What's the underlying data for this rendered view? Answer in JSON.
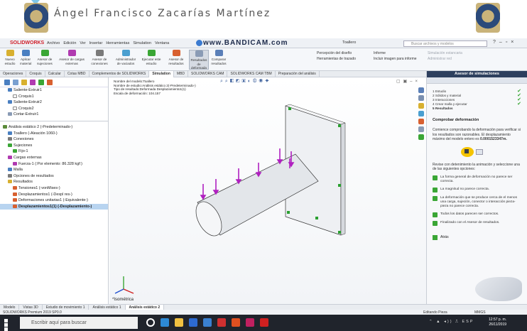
{
  "banner": {
    "author": "Ángel Francisco Zacarías Martínez"
  },
  "menubar": {
    "logo": "SOLIDWORKS",
    "items": [
      "Archivo",
      "Edición",
      "Ver",
      "Insertar",
      "Herramientas",
      "Simulation",
      "Ventana"
    ],
    "watermark": "www.BANDICAM.com",
    "document_title": "Toallero",
    "search_placeholder": "Buscar archivos y modelos"
  },
  "ribbon": {
    "buttons": [
      "Nuevo estudio",
      "Aplicar material",
      "Asesor de sujeciones",
      "Asesor de cargas externas",
      "Asesor de conexiones",
      "Administrador de vaciados",
      "Ejecutar este estudio",
      "Asesor de resultados",
      "Resultados de deformada",
      "Comparar resultados"
    ],
    "list_items": [
      "Percepción del diseño",
      "Herramientas de trazado",
      "Informe",
      "Incluir imagen para informe",
      "Simulación estancaria",
      "Administrar red"
    ]
  },
  "tabs": [
    "Operaciones",
    "Croquis",
    "Calcular",
    "Cotas MBD",
    "Complementos de SOLIDWORKS",
    "Simulation",
    "MBD",
    "SOLIDWORKS CAM",
    "SOLIDWORKS CAM TBM",
    "Preparación del análisis"
  ],
  "active_tab": "Simulation",
  "tree": {
    "features": [
      {
        "label": "Saliente-Extruir1",
        "indent": 1,
        "color": "#4a7fc1"
      },
      {
        "label": "Croquis1",
        "indent": 2,
        "color": "#ffffff"
      },
      {
        "label": "Saliente-Extruir2",
        "indent": 1,
        "color": "#4a7fc1"
      },
      {
        "label": "Croquis2",
        "indent": 2,
        "color": "#ffffff"
      },
      {
        "label": "Cortar-Extruir1",
        "indent": 1,
        "color": "#8a9bb5"
      }
    ],
    "study": [
      {
        "label": "Análisis estático 2 (-Predeterminado-)",
        "indent": 0,
        "color": "#5a8a3a"
      },
      {
        "label": "Toallero (-Aleación 1060-)",
        "indent": 1,
        "color": "#4a7fc1"
      },
      {
        "label": "Conexiones",
        "indent": 1,
        "color": "#7a7a7a"
      },
      {
        "label": "Sujeciones",
        "indent": 1,
        "color": "#3aa635"
      },
      {
        "label": "Fijo-1",
        "indent": 2,
        "color": "#3aa635"
      },
      {
        "label": "Cargas externas",
        "indent": 1,
        "color": "#b03ab0"
      },
      {
        "label": "Fuerza-1 (:Por elemento: 86.328 kgf:)",
        "indent": 2,
        "color": "#b03ab0"
      },
      {
        "label": "Malla",
        "indent": 1,
        "color": "#4a7fc1"
      },
      {
        "label": "Opciones de resultados",
        "indent": 1,
        "color": "#7a7a7a"
      },
      {
        "label": "Resultados",
        "indent": 1,
        "color": "#d8b030"
      },
      {
        "label": "Tensiones1 (-vonMises-)",
        "indent": 2,
        "color": "#d86030"
      },
      {
        "label": "Desplazamientos1 (-Despl res-)",
        "indent": 2,
        "color": "#d86030"
      },
      {
        "label": "Deformaciones unitarias1 (-Equivalente-)",
        "indent": 2,
        "color": "#d86030"
      },
      {
        "label": "Desplazamientos1(1) (-Desplazamiento-)",
        "indent": 2,
        "color": "#d86030",
        "selected": true
      }
    ]
  },
  "graphics": {
    "study_info": [
      "Nombre del modelo:Toallero",
      "Nombre de estudio:Análisis estático 2(-Predeterminado-)",
      "Tipo de resultado:Deformada Desplazamiento1(1)",
      "Escala de deformación: 104.157"
    ],
    "view_label": "*Isométrica",
    "colors": {
      "model": "#e8eaee",
      "load": "#b020c0",
      "fixture": "#2aa030"
    }
  },
  "wizard": {
    "title": "Asesor de simulaciones",
    "steps": [
      {
        "label": "1 Estudio",
        "done": true
      },
      {
        "label": "2 Sólidos y material",
        "done": true
      },
      {
        "label": "3 Interacciones",
        "done": true
      },
      {
        "label": "4 Crear malla y ejecutar",
        "done": true
      },
      {
        "label": "5 Resultados",
        "done": false
      }
    ],
    "section_title": "Comprobar deformación",
    "intro": "Comience comprobando la deformación para verificar si los resultados son razonables. El desplazamiento máximo del modelo entero es",
    "max_displacement": "0.0001523347m.",
    "instruction": "Revise con detenimiento la animación y seleccione una de las siguientes opciones:",
    "options": [
      "La forma general de deformación no parece ser correcta.",
      "La magnitud no parece correcta.",
      "La deformación que se produce cerca de el menos una carga, sujeción, conector o interacción pieza-pieza no parece correcta.",
      "Todos los datos parecen ser correctos.",
      "Finalizado con el Asesor de resultados."
    ],
    "back_label": "Atrás"
  },
  "model_tabs": [
    "Modelo",
    "Vistas 3D",
    "Estudio de movimiento 1",
    "Análisis estático 1",
    "Análisis estático 2"
  ],
  "active_model_tab": "Análisis estático 2",
  "statusbar": {
    "left": "SOLIDWORKS Premium 2019 SP0.0",
    "mode": "Editando Pieza",
    "units": "MMGS"
  },
  "taskbar": {
    "search_placeholder": "Escribir aquí para buscar",
    "language": "ESP",
    "time": "12:57 p. m.",
    "date": "26/11/2019",
    "app_colors": [
      "#ffffff",
      "#2d8ad6",
      "#f0c040",
      "#2d6ad0",
      "#3a80d0",
      "#d03030",
      "#e05020",
      "#c02060",
      "#d02020"
    ]
  }
}
